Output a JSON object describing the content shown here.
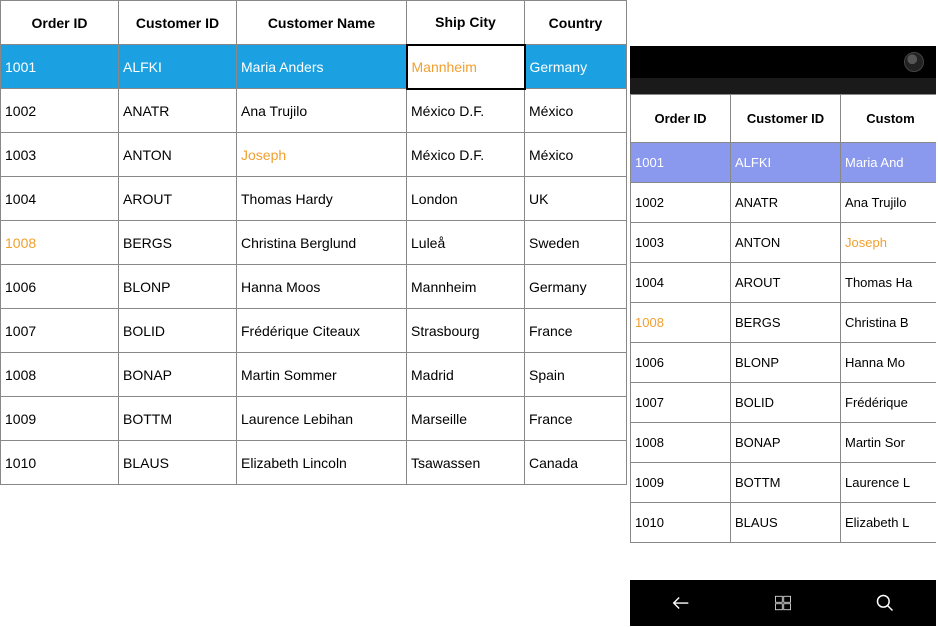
{
  "main_grid": {
    "columns": [
      "Order ID",
      "Customer ID",
      "Customer Name",
      "Ship City",
      "Country"
    ],
    "selected_index": 0,
    "editing_cell": {
      "row": 0,
      "col": 3,
      "value": "Mannheim"
    },
    "highlight_cells": [
      {
        "row": 2,
        "col": 2
      },
      {
        "row": 4,
        "col": 0
      }
    ],
    "rows": [
      {
        "order_id": "1001",
        "customer_id": "ALFKI",
        "customer_name": "Maria Anders",
        "ship_city": "Mannheim",
        "country": "Germany"
      },
      {
        "order_id": "1002",
        "customer_id": "ANATR",
        "customer_name": "Ana Trujilo",
        "ship_city": "México D.F.",
        "country": "México"
      },
      {
        "order_id": "1003",
        "customer_id": "ANTON",
        "customer_name": "Joseph",
        "ship_city": "México D.F.",
        "country": "México"
      },
      {
        "order_id": "1004",
        "customer_id": "AROUT",
        "customer_name": "Thomas Hardy",
        "ship_city": "London",
        "country": "UK"
      },
      {
        "order_id": "1008",
        "customer_id": "BERGS",
        "customer_name": "Christina Berglund",
        "ship_city": "Luleå",
        "country": "Sweden"
      },
      {
        "order_id": "1006",
        "customer_id": "BLONP",
        "customer_name": "Hanna Moos",
        "ship_city": "Mannheim",
        "country": "Germany"
      },
      {
        "order_id": "1007",
        "customer_id": "BOLID",
        "customer_name": "Frédérique Citeaux",
        "ship_city": "Strasbourg",
        "country": "France"
      },
      {
        "order_id": "1008",
        "customer_id": "BONAP",
        "customer_name": "Martin Sommer",
        "ship_city": "Madrid",
        "country": "Spain"
      },
      {
        "order_id": "1009",
        "customer_id": "BOTTM",
        "customer_name": "Laurence Lebihan",
        "ship_city": "Marseille",
        "country": "France"
      },
      {
        "order_id": "1010",
        "customer_id": "BLAUS",
        "customer_name": "Elizabeth Lincoln",
        "ship_city": "Tsawassen",
        "country": "Canada"
      }
    ]
  },
  "phone_grid": {
    "columns": [
      "Order ID",
      "Customer ID",
      "Custom"
    ],
    "selected_index": 0,
    "highlight_cells": [
      {
        "row": 2,
        "col": 2
      },
      {
        "row": 4,
        "col": 0
      }
    ],
    "rows": [
      {
        "c0": "1001",
        "c1": "ALFKI",
        "c2": "Maria And"
      },
      {
        "c0": "1002",
        "c1": "ANATR",
        "c2": "Ana Trujilo"
      },
      {
        "c0": "1003",
        "c1": "ANTON",
        "c2": "Joseph"
      },
      {
        "c0": "1004",
        "c1": "AROUT",
        "c2": "Thomas Ha"
      },
      {
        "c0": "1008",
        "c1": "BERGS",
        "c2": "Christina B"
      },
      {
        "c0": "1006",
        "c1": "BLONP",
        "c2": "Hanna Mo"
      },
      {
        "c0": "1007",
        "c1": "BOLID",
        "c2": "Frédérique"
      },
      {
        "c0": "1008",
        "c1": "BONAP",
        "c2": "Martin Sor"
      },
      {
        "c0": "1009",
        "c1": "BOTTM",
        "c2": "Laurence L"
      },
      {
        "c0": "1010",
        "c1": "BLAUS",
        "c2": "Elizabeth L"
      }
    ]
  },
  "phone_nav": {
    "back": "back",
    "home": "windows",
    "search": "search"
  }
}
